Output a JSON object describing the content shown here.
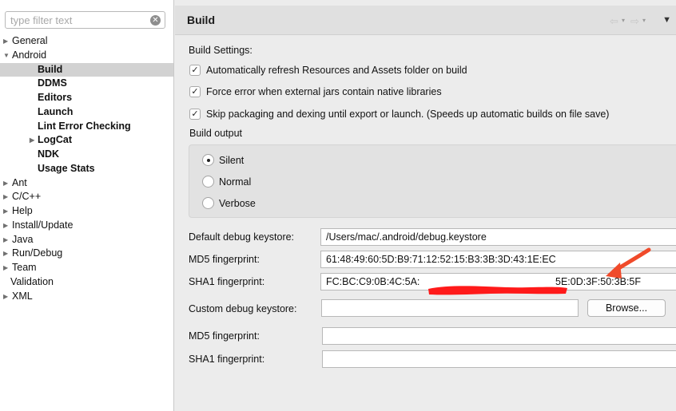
{
  "sidebar": {
    "filter_placeholder": "type filter text",
    "items": [
      {
        "label": "General",
        "state": "collapsed"
      },
      {
        "label": "Android",
        "state": "expanded"
      },
      {
        "label": "Build",
        "selected": true
      },
      {
        "label": "DDMS"
      },
      {
        "label": "Editors"
      },
      {
        "label": "Launch"
      },
      {
        "label": "Lint Error Checking"
      },
      {
        "label": "LogCat",
        "state": "collapsed"
      },
      {
        "label": "NDK"
      },
      {
        "label": "Usage Stats"
      },
      {
        "label": "Ant",
        "state": "collapsed"
      },
      {
        "label": "C/C++",
        "state": "collapsed"
      },
      {
        "label": "Help",
        "state": "collapsed"
      },
      {
        "label": "Install/Update",
        "state": "collapsed"
      },
      {
        "label": "Java",
        "state": "collapsed"
      },
      {
        "label": "Run/Debug",
        "state": "collapsed"
      },
      {
        "label": "Team",
        "state": "collapsed"
      },
      {
        "label": "Validation"
      },
      {
        "label": "XML",
        "state": "collapsed"
      }
    ]
  },
  "header": {
    "title": "Build",
    "icons": [
      "back-arrow-icon",
      "forward-arrow-icon",
      "view-menu-icon"
    ]
  },
  "build_settings": {
    "title": "Build Settings:",
    "checkboxes": [
      {
        "label": "Automatically refresh Resources and Assets folder on build",
        "checked": true
      },
      {
        "label": "Force error when external jars contain native libraries",
        "checked": true
      },
      {
        "label": "Skip packaging and dexing until export or launch. (Speeds up automatic builds on file save)",
        "checked": true
      }
    ],
    "output": {
      "title": "Build output",
      "options": [
        {
          "label": "Silent",
          "selected": true
        },
        {
          "label": "Normal",
          "selected": false
        },
        {
          "label": "Verbose",
          "selected": false
        }
      ]
    }
  },
  "keystore": {
    "default_label": "Default debug keystore:",
    "default_value": "/Users/mac/.android/debug.keystore",
    "md5_label": "MD5 fingerprint:",
    "md5_value": "61:48:49:60:5D:B9:71:12:52:15:B3:3B:3D:43:1E:EC",
    "sha1_label": "SHA1 fingerprint:",
    "sha1_value_start": "FC:BC:C9:0B:4C:5A:",
    "sha1_value_end": "5E:0D:3F:50:3B:5F",
    "custom_label": "Custom debug keystore:",
    "custom_value": "",
    "browse_label": "Browse...",
    "custom_md5_label": "MD5 fingerprint:",
    "custom_md5_value": "",
    "custom_sha1_label": "SHA1 fingerprint:",
    "custom_sha1_value": ""
  },
  "colors": {
    "redaction": "#ff1a1a",
    "annotation_arrow": "#f04a2a",
    "selection": "#d2d2d2"
  }
}
